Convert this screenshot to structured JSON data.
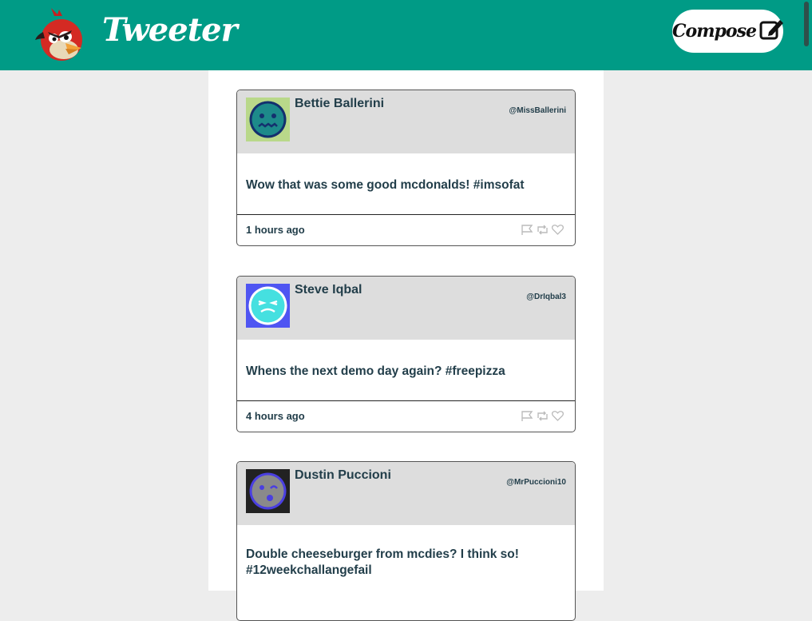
{
  "header": {
    "brand": "Tweeter",
    "compose_label": "Compose",
    "brand_color": "#009b86"
  },
  "tweets": [
    {
      "name": "Bettie Ballerini",
      "handle": "@MissBallerini",
      "content": "Wow that was some good mcdonalds! #imsofat",
      "time": "1 hours ago",
      "avatar_icon": "sick-face-avatar-icon"
    },
    {
      "name": "Steve Iqbal",
      "handle": "@DrIqbal3",
      "content": "Whens the next demo day again? #freepizza",
      "time": "4 hours ago",
      "avatar_icon": "laughing-face-avatar-icon"
    },
    {
      "name": "Dustin Puccioni",
      "handle": "@MrPuccioni10",
      "content": "Double cheeseburger from mcdies? I think so! #12weekchallangefail",
      "time": "",
      "avatar_icon": "winking-face-avatar-icon"
    }
  ]
}
